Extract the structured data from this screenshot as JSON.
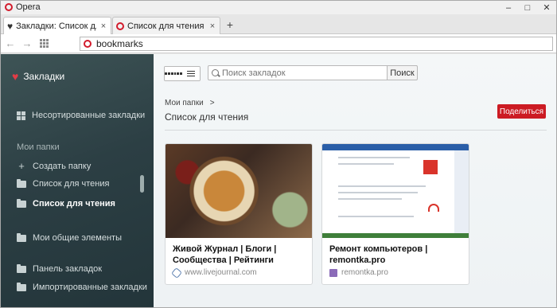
{
  "window": {
    "app_title": "Opera",
    "minimize": "–",
    "maximize": "□",
    "close": "✕"
  },
  "tabs": [
    {
      "label": "Закладки: Список для ч",
      "close": "×"
    },
    {
      "label": "Список для чтения - Op",
      "close": "×"
    }
  ],
  "newtab": "+",
  "toolbar": {
    "back": "←",
    "forward": "→",
    "address": "bookmarks"
  },
  "sidebar": {
    "title": "Закладки",
    "unsorted": "Несортированные закладки",
    "my_folders": "Мои папки",
    "create_folder": "Создать папку",
    "folder1": "Список для чтения",
    "folder2": "Список для чтения",
    "shared": "Мои общие элементы",
    "bookmarks_bar": "Панель закладок",
    "imported": "Импортированные закладки"
  },
  "main": {
    "search_placeholder": "Поиск закладок",
    "search_button": "Поиск",
    "breadcrumb": "Мои папки",
    "breadcrumb_sep": ">",
    "folder_title": "Список для чтения",
    "share_button": "Поделиться",
    "cards": [
      {
        "title": "Живой Журнал | Блоги | Сообщества | Рейтинги",
        "url": "www.livejournal.com"
      },
      {
        "title": "Ремонт компьютеров | remontka.pro",
        "url": "remontka.pro"
      }
    ]
  },
  "colors": {
    "accent": "#cc1b23",
    "sidebar_bg": "#2c3f44",
    "heart": "#e23c46"
  }
}
